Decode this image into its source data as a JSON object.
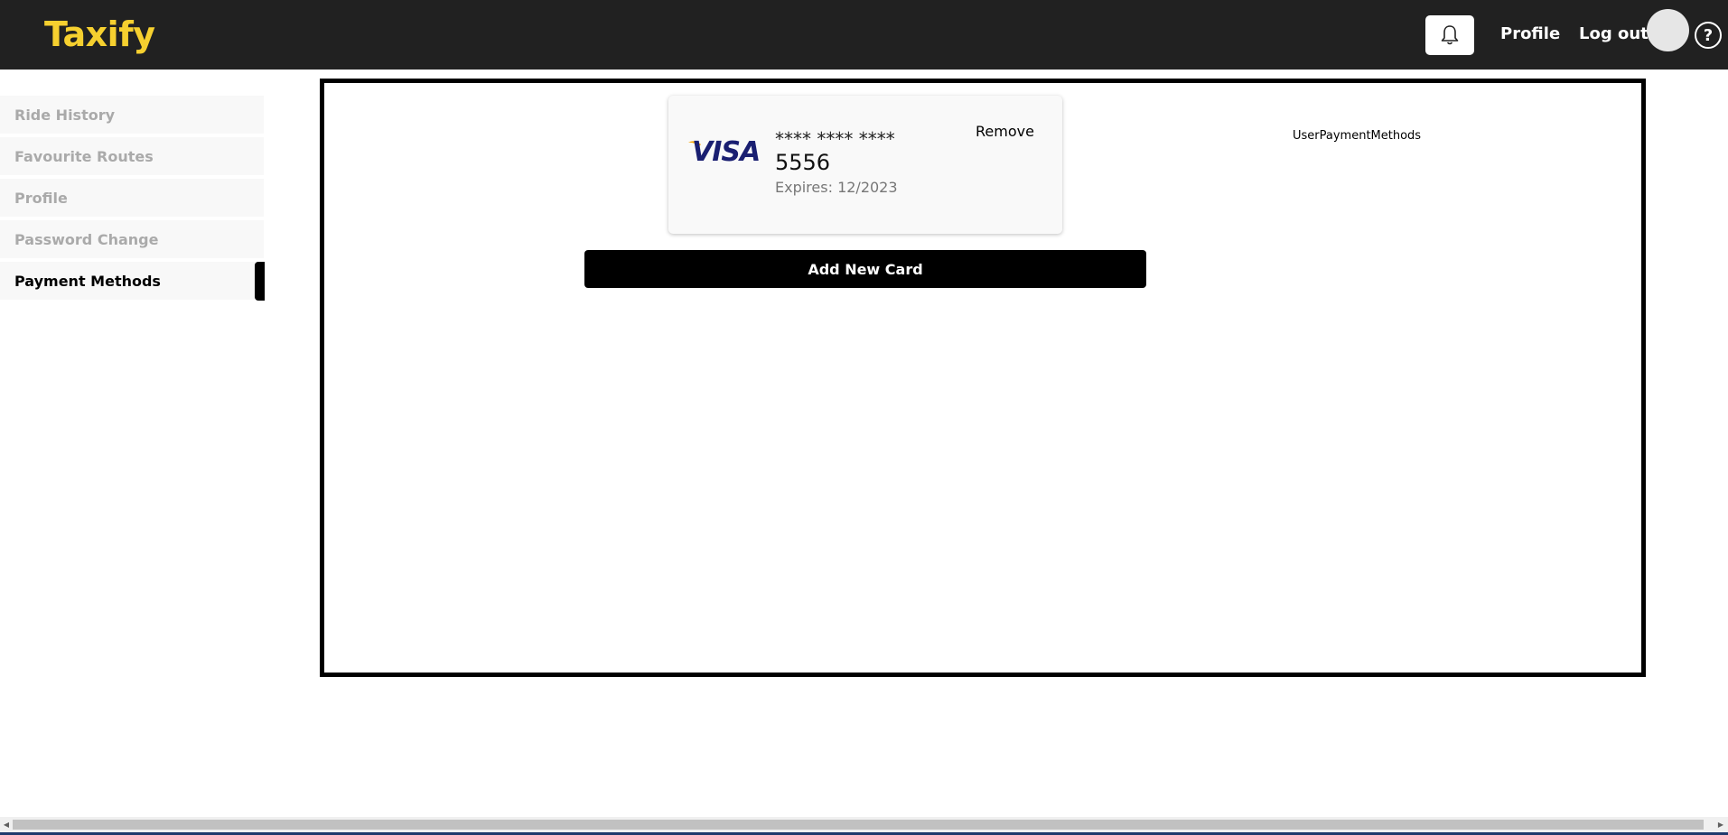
{
  "header": {
    "logo": "Taxify",
    "nav_profile": "Profile",
    "nav_logout": "Log out",
    "help_symbol": "?",
    "icons": [
      "bell-icon",
      "avatar",
      "help-icon"
    ]
  },
  "sidebar": {
    "items": [
      {
        "label": "Ride History",
        "active": false
      },
      {
        "label": "Favourite Routes",
        "active": false
      },
      {
        "label": "Profile",
        "active": false
      },
      {
        "label": "Password Change",
        "active": false
      },
      {
        "label": "Payment Methods",
        "active": true
      }
    ]
  },
  "main": {
    "component_label": "UserPaymentMethods",
    "card": {
      "brand": "VISA",
      "masked_number": "**** **** ****",
      "last4": "5556",
      "expiry": "Expires: 12/2023",
      "remove_label": "Remove"
    },
    "add_card_label": "Add New Card"
  },
  "colors": {
    "topbar": "#212121",
    "logo": "#f6d02f",
    "visa_blue": "#1a1f71",
    "visa_gold": "#f7a600"
  }
}
